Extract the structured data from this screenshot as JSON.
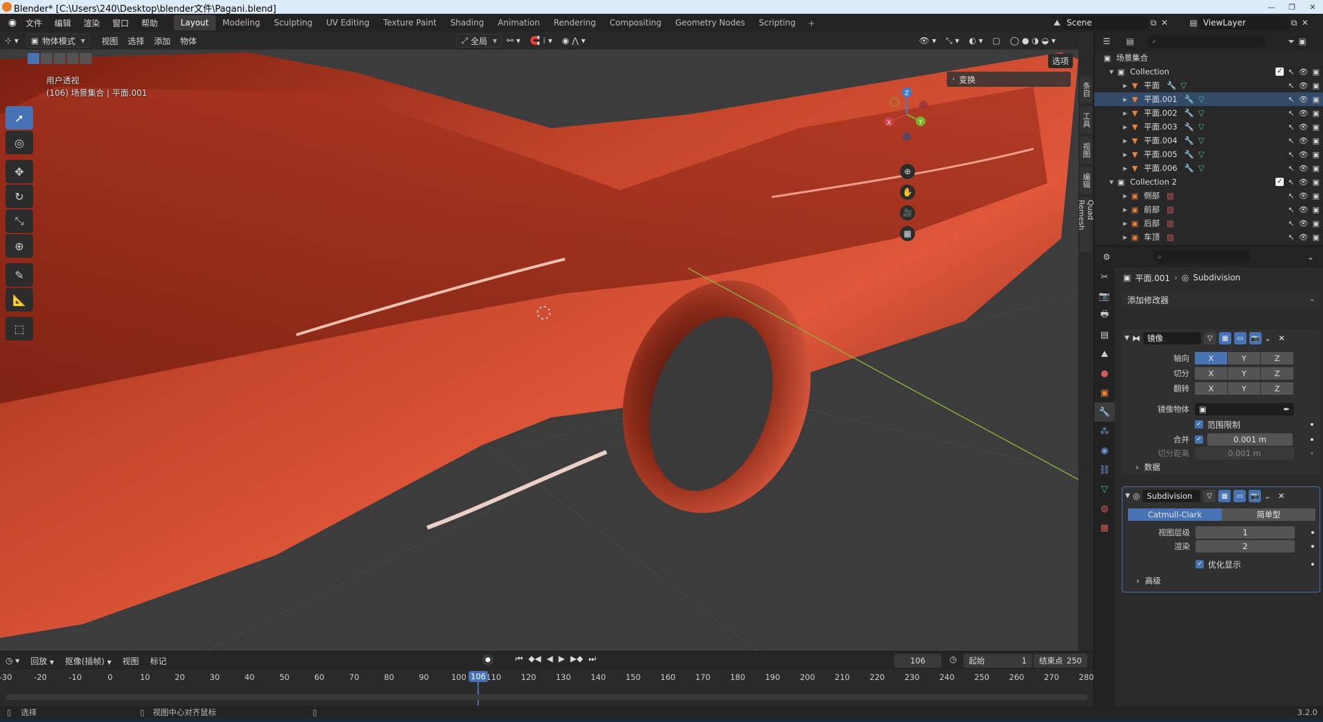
{
  "window": {
    "title": "Blender* [C:\\Users\\240\\Desktop\\blender文件\\Pagani.blend]",
    "controls": [
      "—",
      "❐",
      "✕"
    ]
  },
  "menubar": {
    "menus": [
      "文件",
      "编辑",
      "渲染",
      "窗口",
      "帮助"
    ],
    "workspaces": [
      "Layout",
      "Modeling",
      "Sculpting",
      "UV Editing",
      "Texture Paint",
      "Shading",
      "Animation",
      "Rendering",
      "Compositing",
      "Geometry Nodes",
      "Scripting"
    ],
    "active_workspace": "Layout",
    "add_tab": "+",
    "scene": "Scene",
    "view_layer": "ViewLayer"
  },
  "viewport": {
    "mode": "物体模式",
    "menus": [
      "视图",
      "选择",
      "添加",
      "物体"
    ],
    "orientation": "全局",
    "options": "选项",
    "view_name": "用户透视",
    "view_context": "(106) 场景集合 | 平面.001",
    "n_panel_label": "变换",
    "gizmo_axes": [
      "X",
      "Y",
      "Z"
    ],
    "side_tabs": [
      "条目",
      "工具",
      "视图",
      "编辑",
      "Quad Remesh"
    ],
    "accent_color": "#4772b3",
    "object_color": "#c8442a"
  },
  "outliner": {
    "root": "场景集合",
    "collections": [
      {
        "name": "Collection",
        "items": [
          "平面",
          "平面.001",
          "平面.002",
          "平面.003",
          "平面.004",
          "平面.005",
          "平面.006"
        ]
      },
      {
        "name": "Collection 2",
        "items": [
          "侧部",
          "前部",
          "后部",
          "车顶"
        ]
      }
    ]
  },
  "properties": {
    "object": "平面.001",
    "modifier_crumb": "Subdivision",
    "add_modifier": "添加修改器",
    "mirror": {
      "name": "镜像",
      "axis_label": "轴向",
      "bisect_label": "切分",
      "flip_label": "翻转",
      "axes": [
        "X",
        "Y",
        "Z"
      ],
      "mirror_object_label": "镜像物体",
      "clipping_label": "范围限制",
      "merge_label": "合并",
      "merge_value": "0.001 m",
      "bisect_distance_label": "切分距离",
      "bisect_distance_value": "0.001 m",
      "data_label": "数据"
    },
    "subdivision": {
      "name": "Subdivision",
      "mode_catmull": "Catmull-Clark",
      "mode_simple": "简单型",
      "levels_viewport_label": "视图层级",
      "levels_viewport": "1",
      "render_label": "渲染",
      "render": "2",
      "optimal_label": "优化显示",
      "advanced_label": "高级"
    }
  },
  "timeline": {
    "playback": "回放",
    "keying": "抠像(插帧)",
    "view": "视图",
    "marker": "标记",
    "current_frame": "106",
    "start_label": "起始",
    "start": "1",
    "end_label": "结束点",
    "end": "250",
    "ticks": [
      "-30",
      "-20",
      "-10",
      "0",
      "10",
      "20",
      "30",
      "40",
      "50",
      "60",
      "70",
      "80",
      "90",
      "100",
      "110",
      "120",
      "130",
      "140",
      "150",
      "160",
      "170",
      "180",
      "190",
      "200",
      "210",
      "220",
      "230",
      "240",
      "250",
      "260",
      "270",
      "280"
    ]
  },
  "statusbar": {
    "select": "选择",
    "center_view": "视图中心对齐鼠标",
    "version": "3.2.0"
  }
}
